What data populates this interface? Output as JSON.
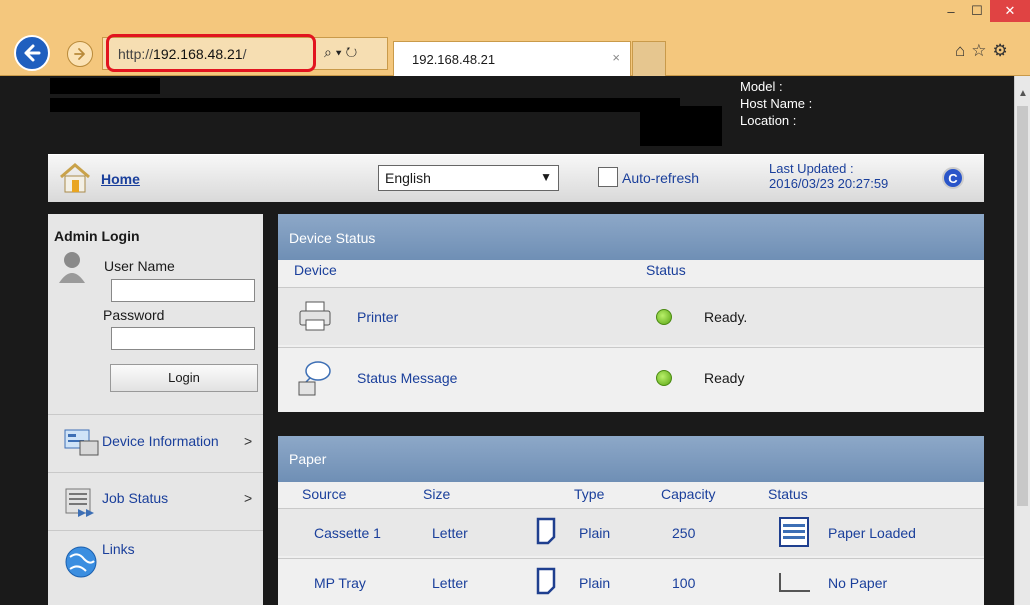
{
  "browser": {
    "window_controls": {
      "minimize": "–",
      "maximize": "☐",
      "close": "✕"
    },
    "url_prefix": "http://",
    "url_host": "192.168.48.21",
    "url_suffix": "/",
    "search_control": "⌕ ▾ ↻",
    "tab_title": "192.168.48.21",
    "tab_close": "×"
  },
  "device_info": {
    "model_label": "Model :",
    "host_label": "Host Name :",
    "location_label": "Location :"
  },
  "navbar": {
    "home_label": "Home",
    "language_value": "English",
    "auto_refresh_label": "Auto-refresh",
    "last_updated_label": "Last Updated :",
    "last_updated_value": "2016/03/23 20:27:59"
  },
  "sidebar": {
    "login_title": "Admin Login",
    "user_label": "User Name",
    "password_label": "Password",
    "login_button": "Login",
    "items": [
      {
        "label": "Device Information",
        "chevron": ">"
      },
      {
        "label": "Job Status",
        "chevron": ">"
      },
      {
        "label": "Links"
      }
    ]
  },
  "device_status": {
    "title": "Device Status",
    "col_device": "Device",
    "col_status": "Status",
    "rows": [
      {
        "name": "Printer",
        "status": "Ready."
      },
      {
        "name": "Status Message",
        "status": "Ready"
      }
    ]
  },
  "paper": {
    "title": "Paper",
    "columns": [
      "Source",
      "Size",
      "Type",
      "Capacity",
      "Status"
    ],
    "rows": [
      {
        "source": "Cassette 1",
        "size": "Letter",
        "type": "Plain",
        "capacity": "250",
        "status": "Paper Loaded"
      },
      {
        "source": "MP Tray",
        "size": "Letter",
        "type": "Plain",
        "capacity": "100",
        "status": "No Paper"
      }
    ]
  },
  "colors": {
    "chrome": "#f4c77d",
    "link": "#1a3f9b",
    "highlight": "#e2141f",
    "card_header": "#7896bd",
    "ready_led": "#5aa514"
  }
}
